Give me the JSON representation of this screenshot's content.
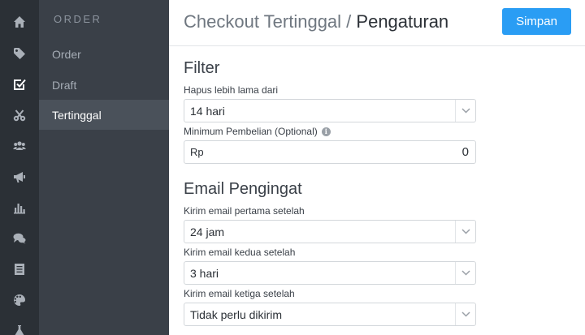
{
  "icon_rail": [
    {
      "icon": "home-icon"
    },
    {
      "icon": "tag-icon"
    },
    {
      "icon": "checkbox-icon",
      "active": true
    },
    {
      "icon": "scissors-icon"
    },
    {
      "icon": "users-icon"
    },
    {
      "icon": "megaphone-icon"
    },
    {
      "icon": "bar-chart-icon"
    },
    {
      "icon": "chat-icon"
    },
    {
      "icon": "document-icon"
    },
    {
      "icon": "palette-icon"
    },
    {
      "icon": "flask-icon"
    }
  ],
  "subnav": {
    "title": "ORDER",
    "items": [
      {
        "label": "Order"
      },
      {
        "label": "Draft"
      },
      {
        "label": "Tertinggal",
        "active": true
      }
    ]
  },
  "header": {
    "breadcrumb_parent": "Checkout Tertinggal /",
    "breadcrumb_current": "Pengaturan",
    "save_label": "Simpan"
  },
  "filter": {
    "title": "Filter",
    "delete_label": "Hapus lebih lama dari",
    "delete_value": "14 hari",
    "min_purchase_label": "Minimum Pembelian (Optional)",
    "currency_prefix": "Rp",
    "min_purchase_value": "0"
  },
  "email": {
    "title": "Email Pengingat",
    "first_label": "Kirim email pertama setelah",
    "first_value": "24 jam",
    "second_label": "Kirim email kedua setelah",
    "second_value": "3 hari",
    "third_label": "Kirim email ketiga setelah",
    "third_value": "Tidak perlu dikirim"
  },
  "colors": {
    "accent": "#2a9df4",
    "rail_bg": "#2b3036",
    "subnav_bg": "#3a4048",
    "subnav_active_bg": "#4a515a"
  }
}
